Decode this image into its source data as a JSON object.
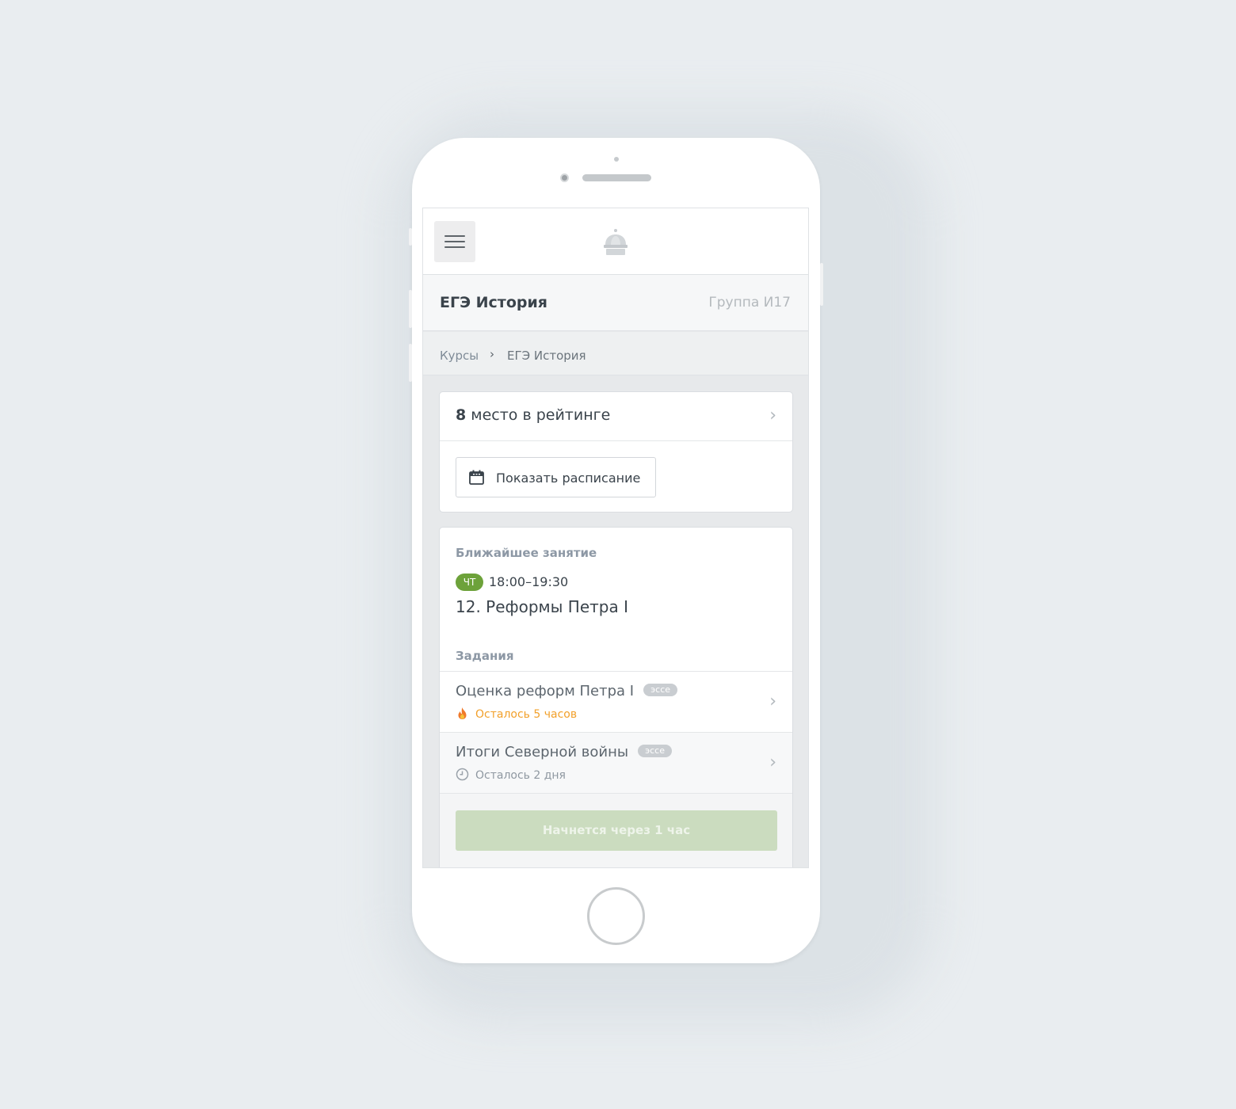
{
  "header": {
    "course_title": "ЕГЭ История",
    "group": "Группа И17"
  },
  "breadcrumb": {
    "root": "Курсы",
    "separator": "›",
    "current": "ЕГЭ История"
  },
  "rating": {
    "place": "8",
    "label": " место в рейтинге"
  },
  "schedule_button": {
    "label": "Показать расписание"
  },
  "next_lesson": {
    "section_label": "Ближайшее занятие",
    "day": "ЧТ",
    "time": "18:00–19:30",
    "title": "12. Реформы Петра I"
  },
  "tasks": {
    "section_label": "Задания",
    "items": [
      {
        "title": "Оценка реформ Петра I",
        "tag": "эссе",
        "deadline": "Осталось 5 часов",
        "status_icon": "fire-icon",
        "urgent": true
      },
      {
        "title": "Итоги Северной войны",
        "tag": "эссе",
        "deadline": "Осталось 2 дня",
        "status_icon": "clock-icon",
        "urgent": false
      }
    ]
  },
  "start_button": {
    "label": "Начнется через 1 час"
  },
  "colors": {
    "accent_green": "#6da23a",
    "disabled_green": "#cbdcbf",
    "warning_orange": "#f2a02a",
    "page_background": "#e9edf0"
  },
  "icons": {
    "menu": "hamburger-icon",
    "logo": "crown-icon",
    "schedule": "calendar-icon",
    "chevron": "chevron-right-icon"
  }
}
